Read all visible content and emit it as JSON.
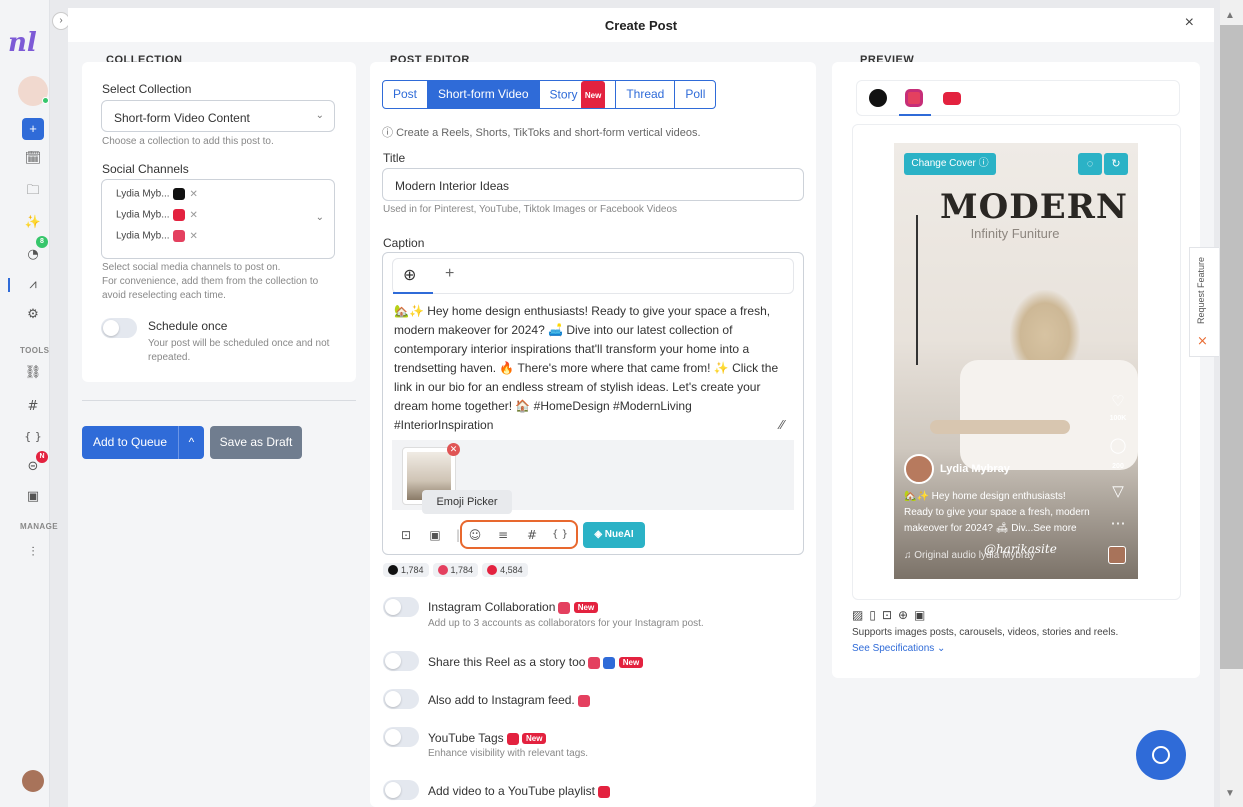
{
  "app": {
    "logo": "nl",
    "title": "Create Post",
    "close": "×"
  },
  "sidebar": {
    "expand": "›",
    "plus": "+",
    "sections": {
      "tools": "TOOLS",
      "manage": "MANAGE"
    },
    "badges": {
      "analytics": "8",
      "links": "N"
    },
    "icons": {
      "calendar": "🗓",
      "folder": "🗀",
      "magic": "✨",
      "analytics": "◔",
      "share": "⩘",
      "settings": "⚙",
      "link": "⛓",
      "hash": "#",
      "braces": "{ }",
      "chain": "⊝",
      "gallery": "▣",
      "sliders": "⫶"
    }
  },
  "collection": {
    "section": "COLLECTION",
    "select_label": "Select Collection",
    "select_value": "Short-form Video Content",
    "select_help": "Choose a collection to add this post to.",
    "channels_label": "Social Channels",
    "channels": [
      {
        "name": "Lydia Myb...",
        "platform": "tiktok",
        "color": "#111111"
      },
      {
        "name": "Lydia Myb...",
        "platform": "youtube",
        "color": "#e3223f"
      },
      {
        "name": "Lydia Myb...",
        "platform": "instagram",
        "color": "#e4405f"
      }
    ],
    "channels_help1": "Select social media channels to post on.",
    "channels_help2": "For convenience, add them from the collection to avoid reselecting each time.",
    "schedule_label": "Schedule once",
    "schedule_help": "Your post will be scheduled once and not repeated."
  },
  "actions": {
    "add_queue": "Add to Queue",
    "caret": "^",
    "save_draft": "Save as Draft"
  },
  "editor": {
    "section": "POST EDITOR",
    "tabs": [
      "Post",
      "Short-form Video",
      "Story",
      "Thread",
      "Poll"
    ],
    "new_badge": "New",
    "info": "Create a Reels, Shorts, TikToks and short-form vertical videos.",
    "title_label": "Title",
    "title_value": "Modern Interior Ideas",
    "title_help": "Used in for Pinterest, YouTube, Tiktok Images or Facebook Videos",
    "caption_label": "Caption",
    "lang_icon": "⊕",
    "lang_add": "+",
    "caption_text": "🏡✨ Hey home design enthusiasts! Ready to give your space a fresh, modern makeover for 2024? 🛋️ Dive into our latest collection of contemporary interior inspirations that'll transform your home into a trendsetting haven. 🔥 There's more where that came from! ✨ Click the link in our bio for an endless stream of stylish ideas. Let's create your dream home together! 🏠 #HomeDesign #ModernLiving #InteriorInspiration",
    "tooltip": "Emoji Picker",
    "toolbar": {
      "nueai": "NueAI"
    },
    "counts": [
      {
        "value": "1,784",
        "color": "#111111"
      },
      {
        "value": "1,784",
        "color": "#e4405f"
      },
      {
        "value": "4,584",
        "color": "#e3223f"
      }
    ],
    "options": [
      {
        "label": "Instagram Collaboration",
        "help": "Add up to 3 accounts as collaborators for your Instagram post."
      },
      {
        "label": "Share this Reel as a story too",
        "help": ""
      },
      {
        "label": "Also add to Instagram feed.",
        "help": ""
      },
      {
        "label": "YouTube Tags",
        "help": "Enhance visibility with relevant tags."
      },
      {
        "label": "Add video to a YouTube playlist",
        "help": ""
      }
    ]
  },
  "preview": {
    "section": "PREVIEW",
    "change_cover": "Change Cover ⓘ",
    "brand": "MODERN",
    "subbrand": "Infinity Funiture",
    "username": "Lydia Mybray",
    "caption_line1": "🏡✨ Hey home design enthusiasts!",
    "caption_line2": "Ready to give your space a fresh, modern",
    "caption_line3": "makeover for 2024? 🛋 Div...See more",
    "handle": "@harikasite",
    "audio": "♫ Original audio lydia Mybray",
    "likes": "100K",
    "comments": "200",
    "supports": "Supports images posts, carousels, videos, stories and reels.",
    "see_spec": "See Specifications ⌄",
    "format_icons": "▨▯⊡⊕▣"
  },
  "request_feature": "Request Feature"
}
